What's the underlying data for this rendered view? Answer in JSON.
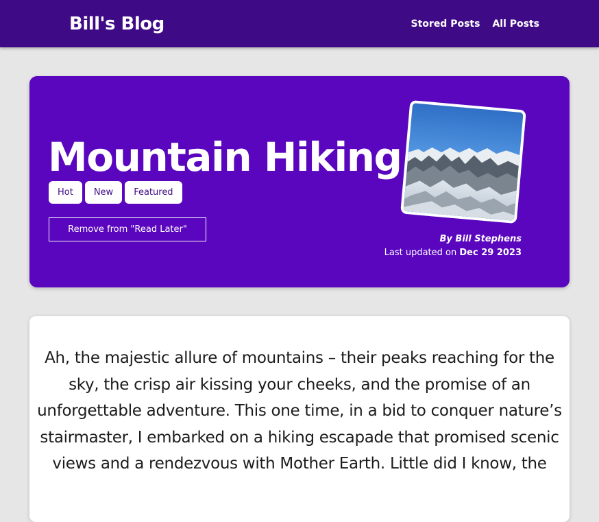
{
  "navbar": {
    "brand": "Bill's Blog",
    "links": [
      "Stored Posts",
      "All Posts"
    ]
  },
  "post": {
    "title": "Mountain Hiking",
    "tags": [
      "Hot",
      "New",
      "Featured"
    ],
    "read_later_button": "Remove from \"Read Later\"",
    "byline": "By Bill Stephens",
    "updated_prefix": "Last updated on ",
    "updated_date": "Dec 29 2023",
    "image_alt": "mountain-landscape-photo",
    "body": "Ah, the majestic allure of mountains – their peaks reaching for the sky, the crisp air kissing your cheeks, and the promise of an unforgettable adventure. This one time, in a bid to conquer nature’s stairmaster, I embarked on a hiking escapade that promised scenic views and a rendezvous with Mother Earth. Little did I know, the"
  },
  "colors": {
    "navbar": "#3f0a86",
    "hero": "#5a06bf",
    "page_bg": "#e6e6e6",
    "card_bg": "#ffffff"
  }
}
